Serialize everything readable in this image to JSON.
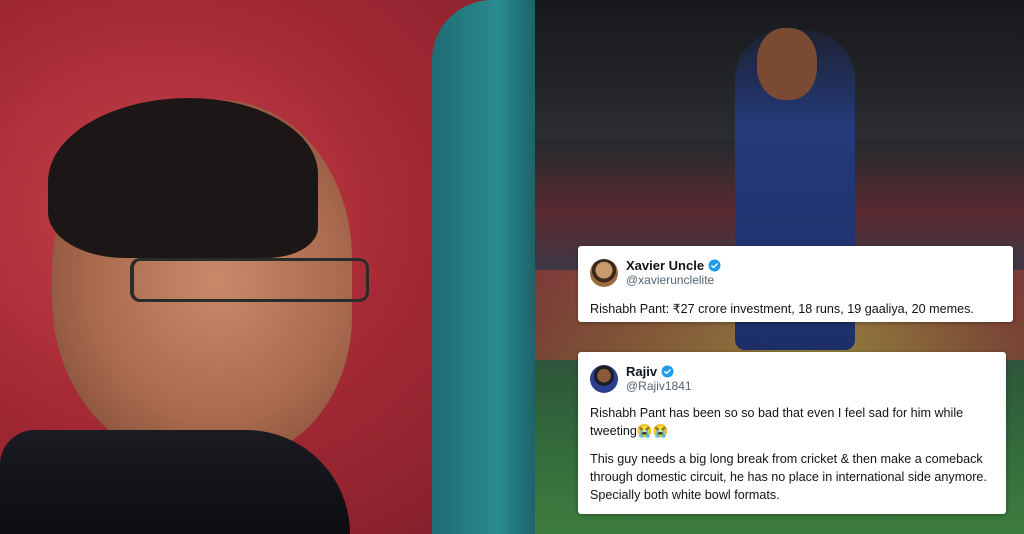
{
  "tweets": [
    {
      "display_name": "Xavier Uncle",
      "handle": "@xavierunclelite",
      "verified": true,
      "text": "Rishabh Pant: ₹27 crore investment, 18 runs, 19 gaaliya, 20 memes."
    },
    {
      "display_name": "Rajiv",
      "handle": "@Rajiv1841",
      "verified": true,
      "text_para1": "Rishabh Pant has been so so bad that even I feel sad for him while tweeting😭😭",
      "text_para2": "This guy needs a big long break from cricket & then make a comeback through domestic circuit, he has no place in international side anymore. Specially both white bowl formats."
    }
  ],
  "colors": {
    "verified_badge": "#1d9bf0",
    "handle_text": "#536471",
    "tweet_text": "#0f1419",
    "card_background": "#ffffff"
  },
  "icons": [
    "verified-badge-icon"
  ]
}
